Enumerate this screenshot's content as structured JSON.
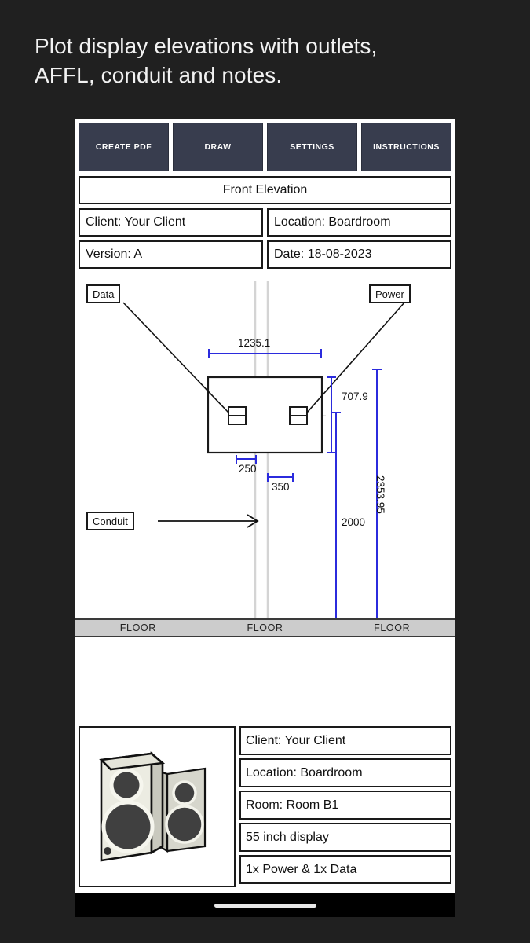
{
  "heading": "Plot display elevations with outlets,\nAFFL, conduit and notes.",
  "toolbar": {
    "buttons": [
      {
        "label": "CREATE PDF",
        "name": "create-pdf"
      },
      {
        "label": "DRAW",
        "name": "draw"
      },
      {
        "label": "SETTINGS",
        "name": "settings"
      },
      {
        "label": "INSTRUCTIONS",
        "name": "instructions"
      }
    ]
  },
  "header": {
    "title": "Front Elevation",
    "client": "Client: Your Client",
    "location": "Location: Boardroom",
    "version": "Version: A",
    "date": "Date: 18-08-2023"
  },
  "drawing": {
    "callouts": {
      "data": "Data",
      "power": "Power",
      "conduit": "Conduit"
    },
    "dimensions": {
      "width": "1235.1",
      "height": "707.9",
      "offset_left": "250",
      "offset_right": "350",
      "affl": "2000",
      "overall": "2353.95"
    },
    "floor_label": "FLOOR",
    "floor_labels": [
      "FLOOR",
      "FLOOR",
      "FLOOR"
    ],
    "colors": {
      "dimension_line": "#2b2bdd",
      "outline": "#1a1a1a",
      "conduit_line": "#d4d4d4",
      "centerline": "#d8d8d8",
      "floor_fill": "#cccccc"
    }
  },
  "specs": {
    "rows": [
      "Client: Your Client",
      "Location: Boardroom",
      "Room: Room B1",
      "55 inch display",
      "1x Power & 1x Data"
    ]
  },
  "thumbnail": {
    "alt": "speaker-pair-illustration"
  },
  "theme": {
    "page_bg": "#202020",
    "button_bg": "#383d4e",
    "card_bg": "#ffffff"
  }
}
